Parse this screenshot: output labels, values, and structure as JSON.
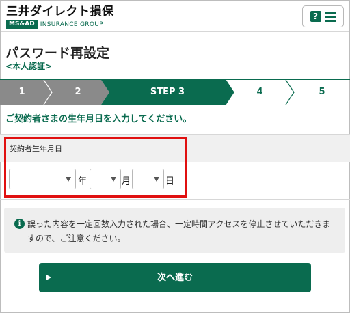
{
  "header": {
    "logo_main": "三井ダイレクト損保",
    "logo_badge": "MS&AD",
    "logo_sub": "INSURANCE GROUP",
    "help_icon": "question-icon",
    "help_mark": "?"
  },
  "page": {
    "title": "パスワード再設定",
    "subtitle": "<本人認証>"
  },
  "steps": {
    "items": [
      {
        "label": "1",
        "state": "done"
      },
      {
        "label": "2",
        "state": "done"
      },
      {
        "label": "STEP 3",
        "state": "current"
      },
      {
        "label": "4",
        "state": "todo"
      },
      {
        "label": "5",
        "state": "todo"
      }
    ]
  },
  "instruction": "ご契約者さまの生年月日を入力してください。",
  "form": {
    "label": "契約者生年月日",
    "year_value": "",
    "year_unit": "年",
    "month_value": "",
    "month_unit": "月",
    "day_value": "",
    "day_unit": "日"
  },
  "notice": {
    "icon": "info-icon",
    "icon_mark": "i",
    "text": "誤った内容を一定回数入力された場合、一定時間アクセスを停止させていただきますので、ご注意ください。"
  },
  "actions": {
    "next_label": "次へ進む"
  },
  "colors": {
    "accent": "#0a6b4f",
    "step_done": "#8a8a8a",
    "highlight": "#e01010"
  }
}
